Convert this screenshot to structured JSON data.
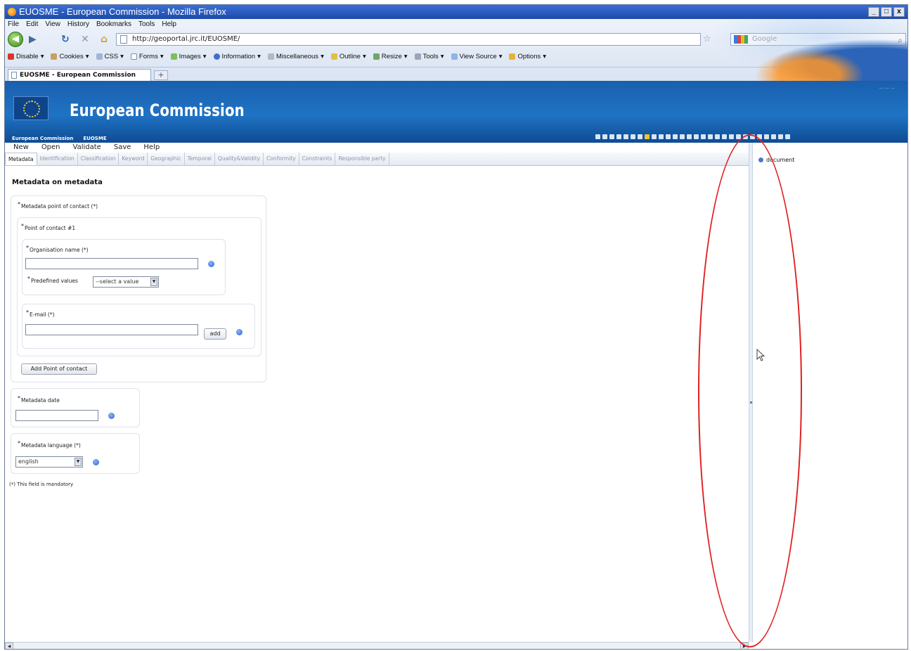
{
  "browser": {
    "window_title": "EUOSME - European Commission - Mozilla Firefox",
    "menu": [
      "File",
      "Edit",
      "View",
      "History",
      "Bookmarks",
      "Tools",
      "Help"
    ],
    "url": "http://geoportal.jrc.it/EUOSME/",
    "search_placeholder": "Google",
    "dev_toolbar": [
      "Disable",
      "Cookies",
      "CSS",
      "Forms",
      "Images",
      "Information",
      "Miscellaneous",
      "Outline",
      "Resize",
      "Tools",
      "View Source",
      "Options"
    ],
    "tab_title": "EUOSME - European Commission"
  },
  "ec": {
    "title": "European Commission",
    "crumbs": [
      "European Commission",
      "EUOSME"
    ]
  },
  "app": {
    "toolbar": [
      "New",
      "Open",
      "Validate",
      "Save",
      "Help"
    ],
    "tabs": [
      "Metadata",
      "Identification",
      "Classification",
      "Keyword",
      "Geographic",
      "Temporal",
      "Quality&Validity",
      "Conformity",
      "Constraints",
      "Responsible party"
    ],
    "active_tab": "Metadata"
  },
  "form": {
    "section_title": "Metadata on metadata",
    "metadata_poc_label": "Metadata point of contact (*)",
    "poc1_label": "Point of contact #1",
    "org_name_label": "Organisation name (*)",
    "org_name_value": "",
    "predefined_label": "Predefined values",
    "predefined_select": "--select a value",
    "email_label": "E-mail (*)",
    "email_value": "",
    "add_button": "add",
    "add_poc_button": "Add Point of contact",
    "metadata_date_label": "Metadata date",
    "metadata_date_value": "",
    "metadata_lang_label": "Metadata language (*)",
    "metadata_lang_value": "english",
    "mandatory_note": "(*) This field is mandatory"
  },
  "tree": {
    "root": "document"
  },
  "colors": {
    "ec_blue": "#1f73c4",
    "annotation_red": "#e02020",
    "info_blue": "#2a5fcf"
  }
}
